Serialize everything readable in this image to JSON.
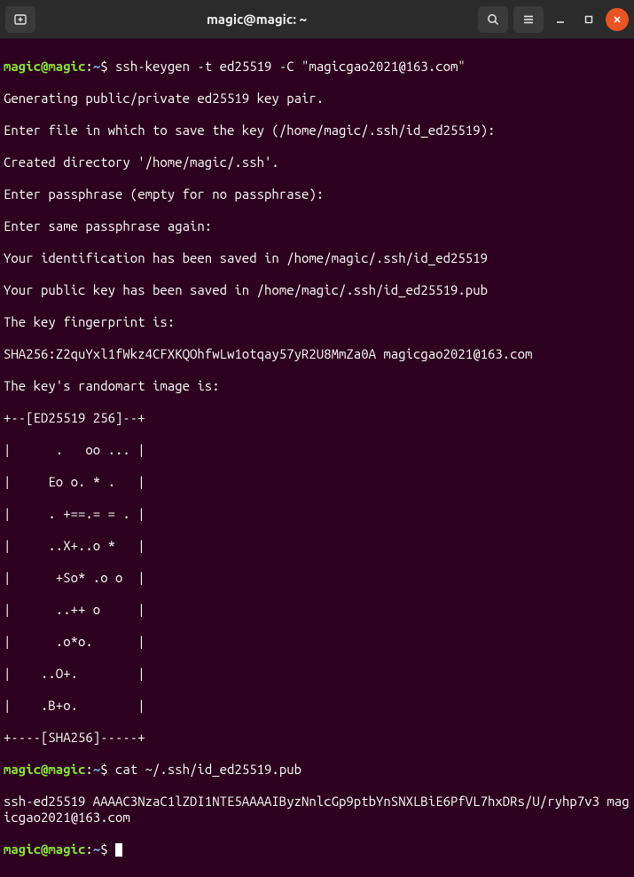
{
  "window": {
    "title": "magic@magic: ~"
  },
  "prompt": {
    "user_host": "magic@magic",
    "path": "~",
    "sep": ":",
    "dollar": "$"
  },
  "session": {
    "cmd1": "ssh-keygen -t ed25519 -C \"magicgao2021@163.com\"",
    "out1": [
      "Generating public/private ed25519 key pair.",
      "Enter file in which to save the key (/home/magic/.ssh/id_ed25519):",
      "Created directory '/home/magic/.ssh'.",
      "Enter passphrase (empty for no passphrase):",
      "Enter same passphrase again:",
      "Your identification has been saved in /home/magic/.ssh/id_ed25519",
      "Your public key has been saved in /home/magic/.ssh/id_ed25519.pub",
      "The key fingerprint is:",
      "SHA256:Z2quYxl1fWkz4CFXKQOhfwLw1otqay57yR2U8MmZa0A magicgao2021@163.com",
      "The key's randomart image is:",
      "+--[ED25519 256]--+",
      "|      .   oo ... |",
      "|     Eo o. * .   |",
      "|     . +==.= = . |",
      "|     ..X+..o *   |",
      "|      +So* .o o  |",
      "|      ..++ o     |",
      "|      .o*o.      |",
      "|    ..O+.        |",
      "|    .B+o.        |",
      "+----[SHA256]-----+"
    ],
    "cmd2": "cat ~/.ssh/id_ed25519.pub",
    "out2": "ssh-ed25519 AAAAC3NzaC1lZDI1NTE5AAAAIByzNnlcGp9ptbYnSNXLBiE6PfVL7hxDRs/U/ryhp7v3 magicgao2021@163.com"
  }
}
